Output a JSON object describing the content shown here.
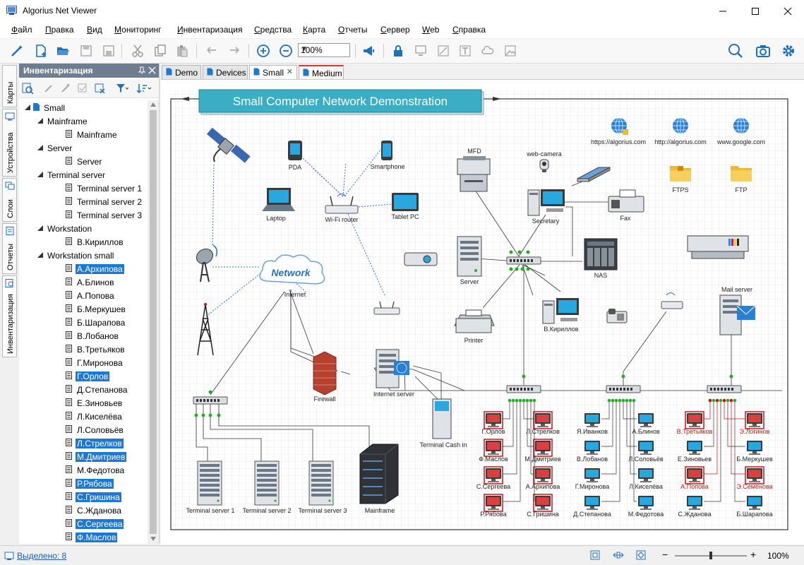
{
  "window": {
    "title": "Algorius Net Viewer"
  },
  "menu": [
    {
      "label": "Файл",
      "u": "Ф",
      "rest": "айл"
    },
    {
      "label": "Правка",
      "u": "П",
      "rest": "равка"
    },
    {
      "label": "Вид",
      "u": "В",
      "rest": "ид"
    },
    {
      "label": "Мониторинг",
      "u": "М",
      "rest": "ониторинг"
    },
    {
      "label": "Инвентаризация",
      "u": "И",
      "rest": "нвентаризация"
    },
    {
      "label": "Средства",
      "u": "С",
      "rest": "редства"
    },
    {
      "label": "Карта",
      "u": "К",
      "rest": "арта"
    },
    {
      "label": "Отчеты",
      "u": "О",
      "rest": "тчеты"
    },
    {
      "label": "Сервер",
      "u": "С",
      "rest": "ервер"
    },
    {
      "label": "Web",
      "u": "W",
      "rest": "eb"
    },
    {
      "label": "Справка",
      "u": "С",
      "rest": "правка"
    }
  ],
  "toolbar": {
    "zoom_value": "100%"
  },
  "vtabs": [
    "Карты",
    "Устройства",
    "Слои",
    "Отчеты",
    "Инвентаризация"
  ],
  "inventory": {
    "title": "Инвентаризация",
    "tree": [
      {
        "label": "Small",
        "level": 0,
        "expanded": true
      },
      {
        "label": "Mainframe",
        "level": 1,
        "expanded": true
      },
      {
        "label": "Mainframe",
        "level": 2
      },
      {
        "label": "Server",
        "level": 1,
        "expanded": true
      },
      {
        "label": "Server",
        "level": 2
      },
      {
        "label": "Terminal server",
        "level": 1,
        "expanded": true
      },
      {
        "label": "Terminal server 1",
        "level": 2
      },
      {
        "label": "Terminal server 2",
        "level": 2
      },
      {
        "label": "Terminal server 3",
        "level": 2
      },
      {
        "label": "Workstation",
        "level": 1,
        "expanded": true
      },
      {
        "label": "В.Кириллов",
        "level": 2
      },
      {
        "label": "Workstation small",
        "level": 1,
        "expanded": true
      },
      {
        "label": "А.Архипова",
        "level": 2,
        "selected": true
      },
      {
        "label": "А.Блинов",
        "level": 2
      },
      {
        "label": "А.Попова",
        "level": 2
      },
      {
        "label": "Б.Меркушев",
        "level": 2
      },
      {
        "label": "Б.Шарапова",
        "level": 2
      },
      {
        "label": "В.Лобанов",
        "level": 2
      },
      {
        "label": "В.Третьяков",
        "level": 2
      },
      {
        "label": "Г.Миронова",
        "level": 2
      },
      {
        "label": "Г.Орлов",
        "level": 2,
        "selected": true
      },
      {
        "label": "Д.Степанова",
        "level": 2
      },
      {
        "label": "Е.Зиновьев",
        "level": 2
      },
      {
        "label": "Л.Киселёва",
        "level": 2
      },
      {
        "label": "Л.Соловьёв",
        "level": 2
      },
      {
        "label": "Л.Стрелков",
        "level": 2,
        "selected": true
      },
      {
        "label": "М.Дмитриев",
        "level": 2,
        "selected": true
      },
      {
        "label": "М.Федотова",
        "level": 2
      },
      {
        "label": "Р.Рябова",
        "level": 2,
        "selected": true
      },
      {
        "label": "С.Гришина",
        "level": 2,
        "selected": true
      },
      {
        "label": "С.Жданова",
        "level": 2
      },
      {
        "label": "С.Сергеева",
        "level": 2,
        "selected": true
      },
      {
        "label": "Ф.Маслов",
        "level": 2,
        "selected": true
      }
    ]
  },
  "doc_tabs": [
    {
      "label": "Demo"
    },
    {
      "label": "Devices"
    },
    {
      "label": "Small",
      "active": true,
      "closable": true
    },
    {
      "label": "Medium",
      "highlight": true
    }
  ],
  "diagram": {
    "title": "Small Computer Network Demonstration",
    "devices": {
      "pda": "PDA",
      "smartphone": "Smartphone",
      "laptop": "Laptop",
      "wifi_router": "Wi-Fi router",
      "tablet": "Tablet PC",
      "mfd": "MFD",
      "webcam": "web-camera",
      "secretary": "Secretary",
      "fax": "Fax",
      "server": "Server",
      "nas": "NAS",
      "network_cloud": "Network",
      "internet": "Internet",
      "printer": "Printer",
      "workstation": "В.Кириллов",
      "mail_server": "Mail server",
      "firewall": "Firewall",
      "internet_server": "Internet server",
      "terminal_cash": "Terminal Cash in",
      "ts1": "Terminal server 1",
      "ts2": "Terminal server 2",
      "ts3": "Terminal server 3",
      "mainframe": "Mainframe",
      "ftps": "FTPS",
      "ftp": "FTP"
    },
    "web_links": [
      "https://algorius.com",
      "http://algorius.com",
      "www.google.com"
    ],
    "workstations": [
      {
        "label": "Г.Орлов",
        "alert": true
      },
      {
        "label": "Л.Стрелков",
        "alert": true
      },
      {
        "label": "Я.Иванков"
      },
      {
        "label": "А.Блинов"
      },
      {
        "label": "В.Третьяков",
        "alert": true,
        "red": true
      },
      {
        "label": "Э.Логинов",
        "alert": true,
        "red": true
      },
      {
        "label": "Ф.Маслов",
        "alert": true
      },
      {
        "label": "М.Дмитриев",
        "alert": true
      },
      {
        "label": "В.Лобанов"
      },
      {
        "label": "Л.Соловьёв"
      },
      {
        "label": "Е.Зиновьев"
      },
      {
        "label": "Б.Меркушев"
      },
      {
        "label": "С.Сергеева",
        "alert": true
      },
      {
        "label": "А.Архипова",
        "alert": true
      },
      {
        "label": "Г.Миронова"
      },
      {
        "label": "Л.Киселёва"
      },
      {
        "label": "А.Попова",
        "alert": true,
        "red": true
      },
      {
        "label": "Э.Семёнова",
        "alert": true,
        "red": true
      },
      {
        "label": "Р.Рябова",
        "alert": true
      },
      {
        "label": "С.Гришина",
        "alert": true
      },
      {
        "label": "Д.Степанова"
      },
      {
        "label": "М.Федотова"
      },
      {
        "label": "С.Жданова"
      },
      {
        "label": "Б.Шарапова"
      }
    ]
  },
  "status": {
    "selected": "Выделено: 8",
    "zoom": "100%"
  },
  "colors": {
    "selection": "#1e78d2",
    "title_box": "#3aaec4",
    "alert": "#d01010",
    "panel_header": "#6e7d8f"
  }
}
